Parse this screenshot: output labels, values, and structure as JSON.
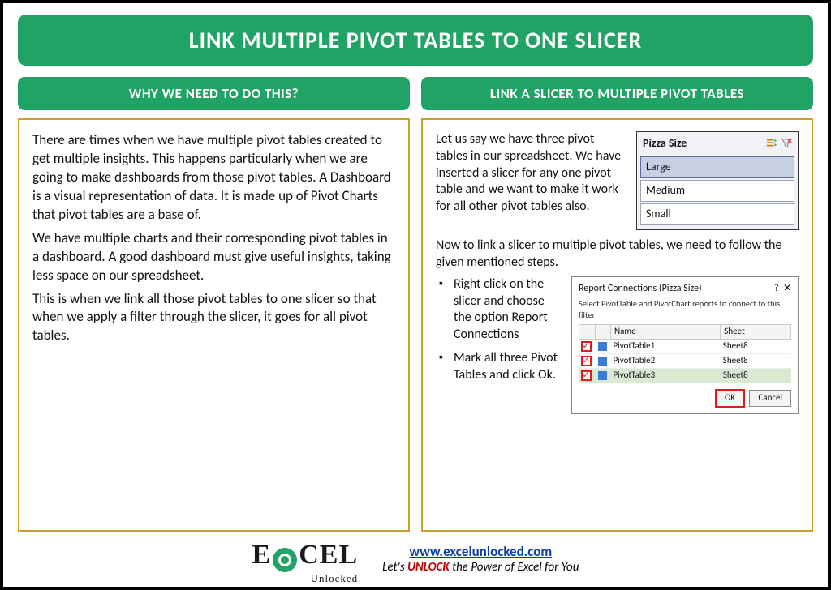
{
  "title": "LINK MULTIPLE PIVOT TABLES TO ONE SLICER",
  "left": {
    "heading": "WHY WE NEED TO DO THIS?",
    "p1": "There are times when we have multiple pivot tables created to get multiple insights. This happens particularly when we are going to make dashboards from those pivot tables. A Dashboard is a visual representation of data. It is made up of Pivot Charts that pivot tables are a base of.",
    "p2": "We have multiple charts and their corresponding pivot tables in a dashboard. A good dashboard must give useful insights, taking less space on our spreadsheet.",
    "p3": "This is when we link all those pivot tables to one slicer so that when we apply a filter through the slicer, it goes for all pivot tables."
  },
  "right": {
    "heading": "LINK A SLICER TO MULTIPLE PIVOT TABLES",
    "intro": "Let us say we have three pivot tables in our spreadsheet. We have inserted a slicer for any one pivot table and we want to make it work for all other pivot tables also.",
    "slicer": {
      "title": "Pizza Size",
      "options": [
        "Large",
        "Medium",
        "Small"
      ],
      "selected": "Large"
    },
    "bridge": "Now to link a slicer to multiple pivot tables, we need to follow the given mentioned steps.",
    "steps": [
      "Right click on the slicer and choose the option Report Connections",
      "Mark all three Pivot Tables and click Ok."
    ],
    "dialog": {
      "title": "Report Connections (Pizza Size)",
      "subtitle": "Select PivotTable and PivotChart reports to connect to this filter",
      "headers": [
        "Name",
        "Sheet"
      ],
      "rows": [
        {
          "name": "PivotTable1",
          "sheet": "Sheet8"
        },
        {
          "name": "PivotTable2",
          "sheet": "Sheet8"
        },
        {
          "name": "PivotTable3",
          "sheet": "Sheet8"
        }
      ],
      "ok": "OK",
      "cancel": "Cancel"
    }
  },
  "footer": {
    "logo_main": "E   CEL",
    "logo_x": "X",
    "logo_sub": "Unlocked",
    "url": "www.excelunlocked.com",
    "tag_pre": "Let's ",
    "tag_unlock": "UNLOCK",
    "tag_post": " the Power of Excel for You"
  }
}
